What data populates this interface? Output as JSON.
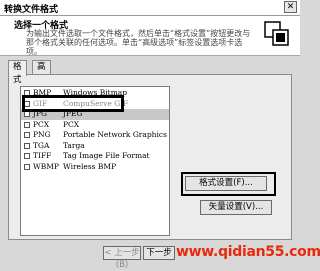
{
  "window": {
    "title": "转换文件格式"
  },
  "header": {
    "title": "选择一个格式",
    "description": "为输出文件选取一个文件格式，然后单击“格式设置”按钮更改与那个格式关联的任何选项。单击“高级选项”标签设置选项卡选项。"
  },
  "tabs": [
    {
      "label": "格式"
    },
    {
      "label": "高级选项"
    }
  ],
  "formats": [
    {
      "code": "BMP",
      "name": "Windows Bitmap"
    },
    {
      "code": "GIF",
      "name": "CompuServe GIF"
    },
    {
      "code": "JPG",
      "name": "JPEG"
    },
    {
      "code": "PCX",
      "name": "PCX"
    },
    {
      "code": "PNG",
      "name": "Portable Network Graphics"
    },
    {
      "code": "TGA",
      "name": "Targa"
    },
    {
      "code": "TIFF",
      "name": "Tag Image File Format"
    },
    {
      "code": "WBMP",
      "name": "Wireless BMP"
    }
  ],
  "buttons": {
    "format_settings": "格式设置(F)...",
    "vector_settings": "矢量设置(V)...",
    "back": "< 上一步(B)",
    "next": "下一步"
  },
  "watermark": "www.qidian55.com",
  "colors": {
    "watermark": "#e8290b",
    "highlight": "#000000"
  }
}
